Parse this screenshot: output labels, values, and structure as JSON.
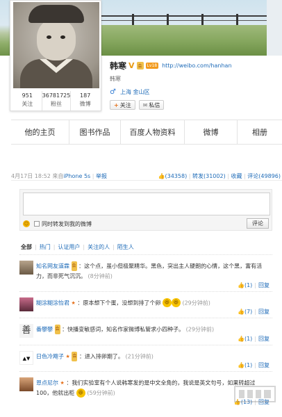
{
  "profile": {
    "name": "韩寒",
    "verified_mark": "V",
    "vip_badge": "会",
    "level_badge": "Lv18",
    "url": "http://weibo.com/hanhan",
    "subname": "韩寒",
    "gender_icon": "male-icon",
    "location": "上海 金山区",
    "follow_label": "关注",
    "message_label": "私信",
    "stats": [
      {
        "num": "951",
        "label": "关注"
      },
      {
        "num": "36781725",
        "label": "粉丝"
      },
      {
        "num": "187",
        "label": "微博"
      }
    ]
  },
  "tabs": [
    "他的主页",
    "图书作品",
    "百度人物资料",
    "微博",
    "相册"
  ],
  "post": {
    "date": "4月17日 18:52",
    "source_prefix": "来自",
    "source": "iPhone 5s",
    "report": "举报",
    "likes": "(34358)",
    "repost": "转发(31002)",
    "favorite": "收藏",
    "comments": "评论(49896)"
  },
  "comment_box": {
    "checkbox_label": "同时转发到我的微博",
    "submit_label": "评论"
  },
  "filters": {
    "all": "全部",
    "items": [
      "热门",
      "认证用户",
      "关注的人",
      "陌生人"
    ]
  },
  "comments": [
    {
      "user": "知名网友道霖",
      "badge": "会",
      "text": "：这个点，虽小但极聚精华。黑色，突出主人硬朗的心情，这个黑，富有活力，而非死气沉沉。",
      "time": "(8分钟前)",
      "likes": "(1)",
      "reply": "回复"
    },
    {
      "user": "糊涂糊涂怡君",
      "badge": "",
      "text": "：原本想下个蛋，没想到排了个卵",
      "time": "(29分钟前)",
      "likes": "(7)",
      "reply": "回复"
    },
    {
      "user": "番攀攀",
      "badge": "会",
      "text": "：快播变敏感词，知名作家微博私管求小四种子。",
      "time": "(29分钟前)",
      "likes": "(1)",
      "reply": "回复"
    },
    {
      "user": "日色冷飕子",
      "badge": "会",
      "text": "：进入排卵期了。",
      "time": "(21分钟前)",
      "likes": "(1)",
      "reply": "回复"
    },
    {
      "user": "恩点尼尔",
      "badge": "",
      "text": "：我们实验室有个人说韩寒发的是中文全角的，我说是英文句号，如果转超过100，他就出柜",
      "time": "(59分钟前)",
      "likes": "(13)",
      "reply": "回复"
    }
  ]
}
